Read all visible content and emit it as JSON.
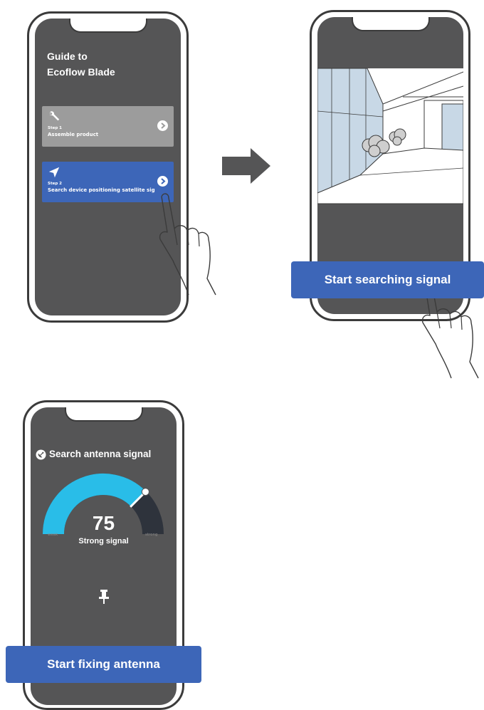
{
  "screen1": {
    "title_line1": "Guide to",
    "title_line2": "Ecoflow Blade",
    "steps": [
      {
        "number": "Step 1",
        "label": "Assemble product",
        "icon": "wrench-icon",
        "state": "inactive"
      },
      {
        "number": "Step 2",
        "label": "Search device positioning satellite sig",
        "icon": "navigation-arrow-icon",
        "state": "active"
      }
    ]
  },
  "screen2": {
    "button_label": "Start searching signal"
  },
  "screen3": {
    "title": "Search antenna signal",
    "title_icon": "satellite-dish-icon",
    "signal_value": "75",
    "signal_status": "Strong signal",
    "gauge_min_label": "weak",
    "gauge_max_label": "strong",
    "gauge_fraction": 0.75,
    "pin_icon": "pin-icon",
    "button_label": "Start fixing antenna"
  },
  "colors": {
    "screen_bg": "#555556",
    "primary_blue": "#3d66b8",
    "gauge_cyan": "#29bde8",
    "gauge_dark": "#2e333c",
    "inactive_card": "#9c9c9c"
  }
}
